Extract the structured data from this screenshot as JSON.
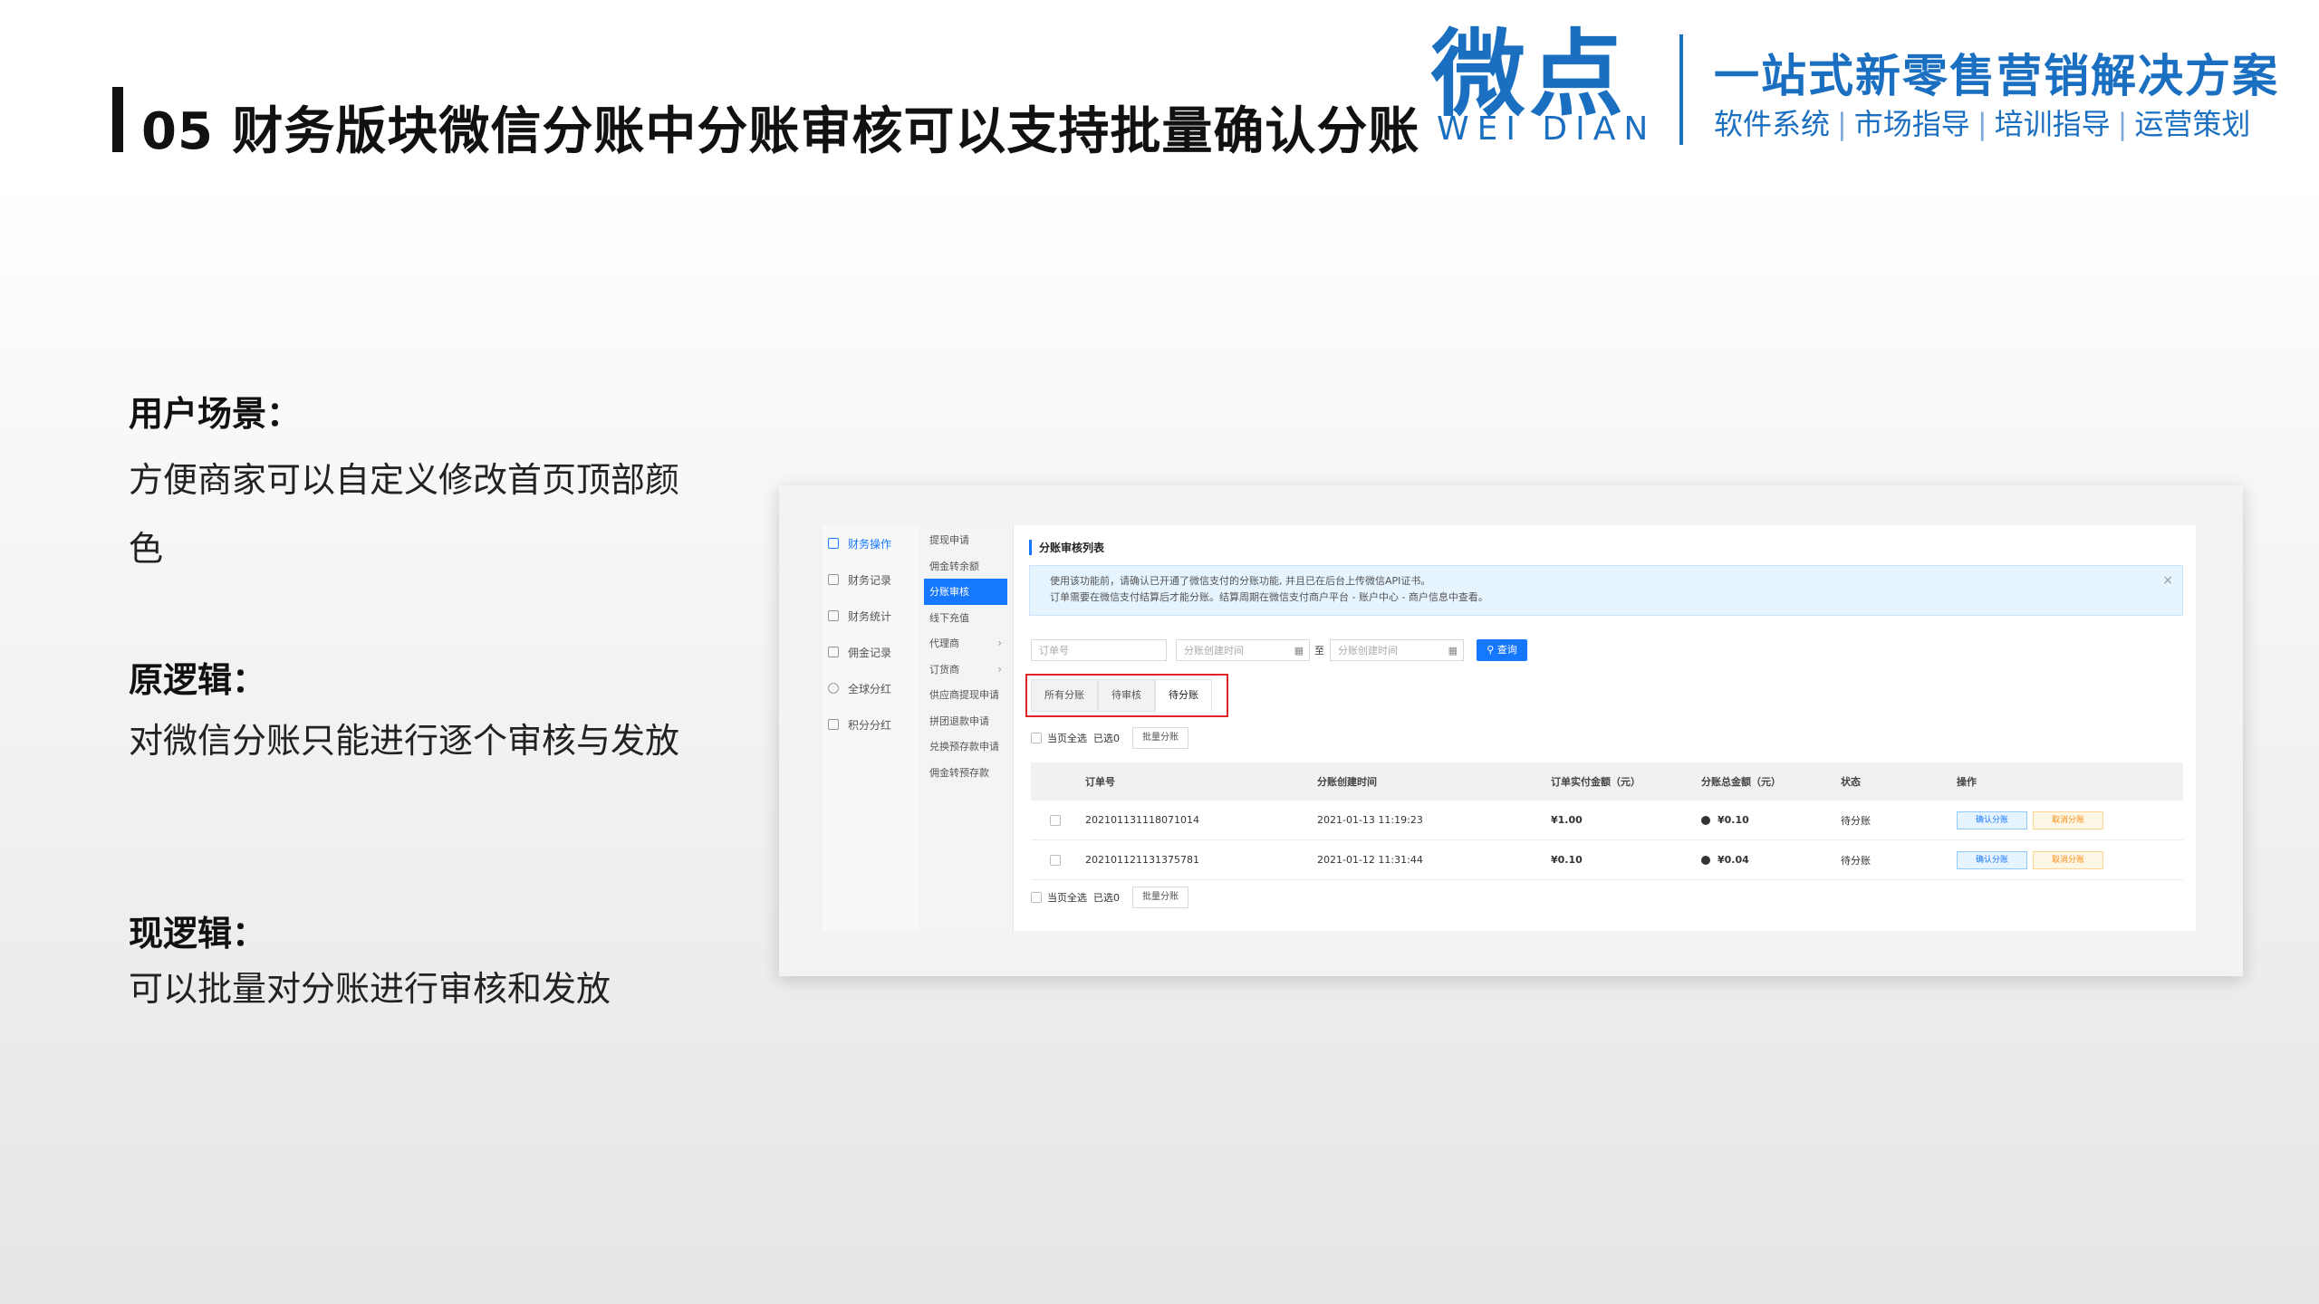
{
  "slide": {
    "title": "05 财务版块微信分账中分账审核可以支持批量确认分账"
  },
  "logo": {
    "cn": "微点",
    "en": "WEI DIAN",
    "slogan": "一站式新零售营销解决方案",
    "services": [
      "软件系统",
      "市场指导",
      "培训指导",
      "运营策划"
    ],
    "brand_color": "#1b6fc0"
  },
  "sections": {
    "scene_heading": "用户场景：",
    "scene_text": "方便商家可以自定义修改首页顶部颜色",
    "old_heading": "原逻辑：",
    "old_text": "对微信分账只能进行逐个审核与发放",
    "new_heading": "现逻辑：",
    "new_text": "可以批量对分账进行审核和发放"
  },
  "app": {
    "nav_primary": [
      {
        "label": "财务操作",
        "icon": "finance-op-icon",
        "active": true
      },
      {
        "label": "财务记录",
        "icon": "record-icon"
      },
      {
        "label": "财务统计",
        "icon": "stats-icon"
      },
      {
        "label": "佣金记录",
        "icon": "commission-icon"
      },
      {
        "label": "全球分红",
        "icon": "globe-icon"
      },
      {
        "label": "积分分红",
        "icon": "points-icon"
      }
    ],
    "nav_secondary": [
      {
        "label": "提现申请"
      },
      {
        "label": "佣金转余额"
      },
      {
        "label": "分账审核",
        "active": true
      },
      {
        "label": "线下充值"
      },
      {
        "label": "代理商",
        "chevron": "›"
      },
      {
        "label": "订货商",
        "chevron": "›"
      },
      {
        "label": "供应商提现申请"
      },
      {
        "label": "拼团退款申请"
      },
      {
        "label": "兑换预存款申请"
      },
      {
        "label": "佣金转预存款"
      }
    ],
    "page_title": "分账审核列表",
    "alert": {
      "line1": "使用该功能前，请确认已开通了微信支付的分账功能, 并且已在后台上传微信API证书。",
      "line2": "订单需要在微信支付结算后才能分账。结算周期在微信支付商户平台 - 账户中心 - 商户信息中查看。",
      "close": "×"
    },
    "filters": {
      "order_placeholder": "订单号",
      "start_placeholder": "分账创建时间",
      "to_label": "至",
      "end_placeholder": "分账创建时间",
      "query_label": "查询",
      "query_icon": "search-icon"
    },
    "tabs": [
      "所有分账",
      "待审核",
      "待分账"
    ],
    "active_tab": "待分账",
    "bulk": {
      "select_all": "当页全选",
      "selected": "已选0",
      "bulk_button": "批量分账"
    },
    "table": {
      "headers": [
        "订单号",
        "分账创建时间",
        "订单实付金额（元）",
        "分账总金额（元）",
        "状态",
        "操作"
      ],
      "rows": [
        {
          "order": "202101131118071014",
          "time": "2021-01-13 11:19:23",
          "paid": "¥1.00",
          "split": "¥0.10",
          "status": "待分账",
          "confirm": "确认分账",
          "cancel": "取消分账"
        },
        {
          "order": "202101121131375781",
          "time": "2021-01-12 11:31:44",
          "paid": "¥0.10",
          "split": "¥0.04",
          "status": "待分账",
          "confirm": "确认分账",
          "cancel": "取消分账"
        }
      ]
    },
    "accent_color": "#1677ff",
    "highlight_color": "#e0242b"
  }
}
